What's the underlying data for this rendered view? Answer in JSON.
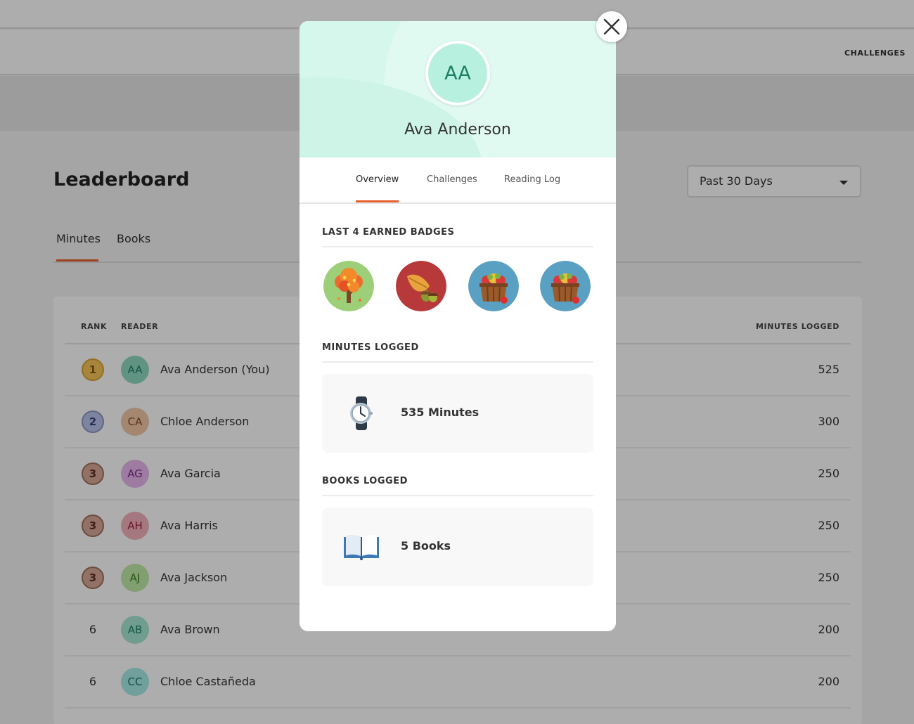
{
  "nav": {
    "challenges_label": "CHALLENGES"
  },
  "leaderboard": {
    "title": "Leaderboard",
    "period_select": {
      "value": "Past 30 Days"
    },
    "tabs": [
      {
        "label": "Minutes",
        "active": true
      },
      {
        "label": "Books",
        "active": false
      }
    ],
    "columns": {
      "rank": "RANK",
      "reader": "READER",
      "minutes": "MINUTES LOGGED"
    },
    "rows": [
      {
        "rank": "1",
        "medal": "gold",
        "initials": "AA",
        "name": "Ava Anderson (You)",
        "minutes": "525",
        "avatar_bg": "#8fd9c2",
        "avatar_color": "#1c7f62"
      },
      {
        "rank": "2",
        "medal": "silver",
        "initials": "CA",
        "name": "Chloe Anderson",
        "minutes": "300",
        "avatar_bg": "#f1c7a6",
        "avatar_color": "#8a4a1d"
      },
      {
        "rank": "3",
        "medal": "bronze",
        "initials": "AG",
        "name": "Ava Garcia",
        "minutes": "250",
        "avatar_bg": "#e9b5ee",
        "avatar_color": "#7d2a8a"
      },
      {
        "rank": "3",
        "medal": "bronze",
        "initials": "AH",
        "name": "Ava Harris",
        "minutes": "250",
        "avatar_bg": "#f4b1bd",
        "avatar_color": "#9a2038"
      },
      {
        "rank": "3",
        "medal": "bronze",
        "initials": "AJ",
        "name": "Ava Jackson",
        "minutes": "250",
        "avatar_bg": "#bfeaa5",
        "avatar_color": "#3e7d1c"
      },
      {
        "rank": "6",
        "medal": "none",
        "initials": "AB",
        "name": "Ava Brown",
        "minutes": "200",
        "avatar_bg": "#a6e8d5",
        "avatar_color": "#1c7f62"
      },
      {
        "rank": "6",
        "medal": "none",
        "initials": "CC",
        "name": "Chloe Castañeda",
        "minutes": "200",
        "avatar_bg": "#a6eae6",
        "avatar_color": "#19716c"
      }
    ]
  },
  "profile_modal": {
    "initials": "AA",
    "name": "Ava Anderson",
    "tabs": [
      {
        "label": "Overview",
        "active": true
      },
      {
        "label": "Challenges",
        "active": false
      },
      {
        "label": "Reading Log",
        "active": false
      }
    ],
    "badges_title": "LAST 4 EARNED BADGES",
    "badges": [
      {
        "icon": "autumn-tree-badge-icon"
      },
      {
        "icon": "oak-leaf-acorn-badge-icon"
      },
      {
        "icon": "apple-basket-badge-icon"
      },
      {
        "icon": "apple-basket-badge-icon"
      }
    ],
    "minutes_title": "MINUTES LOGGED",
    "minutes_value": "535 Minutes",
    "books_title": "BOOKS LOGGED",
    "books_value": "5 Books"
  },
  "colors": {
    "accent": "#e8602c",
    "header_mint": "#d5f7ec",
    "overlay": "rgba(0,0,0,0.32)"
  }
}
